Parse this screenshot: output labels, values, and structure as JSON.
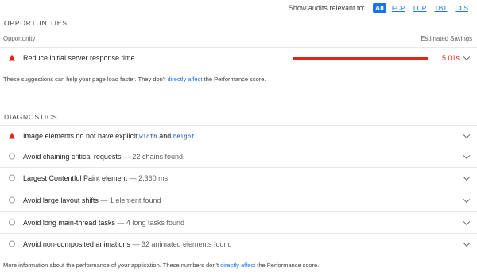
{
  "filter": {
    "label": "Show audits relevant to:",
    "chips": [
      "All",
      "FCP",
      "LCP",
      "TBT",
      "CLS"
    ],
    "active": "All"
  },
  "opportunities": {
    "title": "OPPORTUNITIES",
    "col_left": "Opportunity",
    "col_right": "Estimated Savings",
    "items": [
      {
        "title": "Reduce initial server response time",
        "savings": "5.01s",
        "status": "fail"
      }
    ],
    "note": {
      "before": "These suggestions can help your page load faster. They don't",
      "link": "directly affect",
      "after": "the Performance score."
    }
  },
  "diagnostics": {
    "title": "DIAGNOSTICS",
    "items": [
      {
        "title_before": "Image elements do not have explicit",
        "code1": "width",
        "mid": "and",
        "code2": "height",
        "status": "fail"
      },
      {
        "title": "Avoid chaining critical requests",
        "value": "— 22 chains found",
        "status": "info"
      },
      {
        "title": "Largest Contentful Paint element",
        "value": "— 2,360 ms",
        "status": "info"
      },
      {
        "title": "Avoid large layout shifts",
        "value": "— 1 element found",
        "status": "info"
      },
      {
        "title": "Avoid long main-thread tasks",
        "value": "— 4 long tasks found",
        "status": "info"
      },
      {
        "title": "Avoid non-composited animations",
        "value": "— 32 animated elements found",
        "status": "info"
      }
    ],
    "note": {
      "before": "More information about the performance of your application. These numbers don't",
      "link": "directly affect",
      "after": "the Performance score."
    }
  },
  "colors": {
    "fail": "#e0251b",
    "link": "#1a73e8",
    "accent": "#1a73e8"
  }
}
